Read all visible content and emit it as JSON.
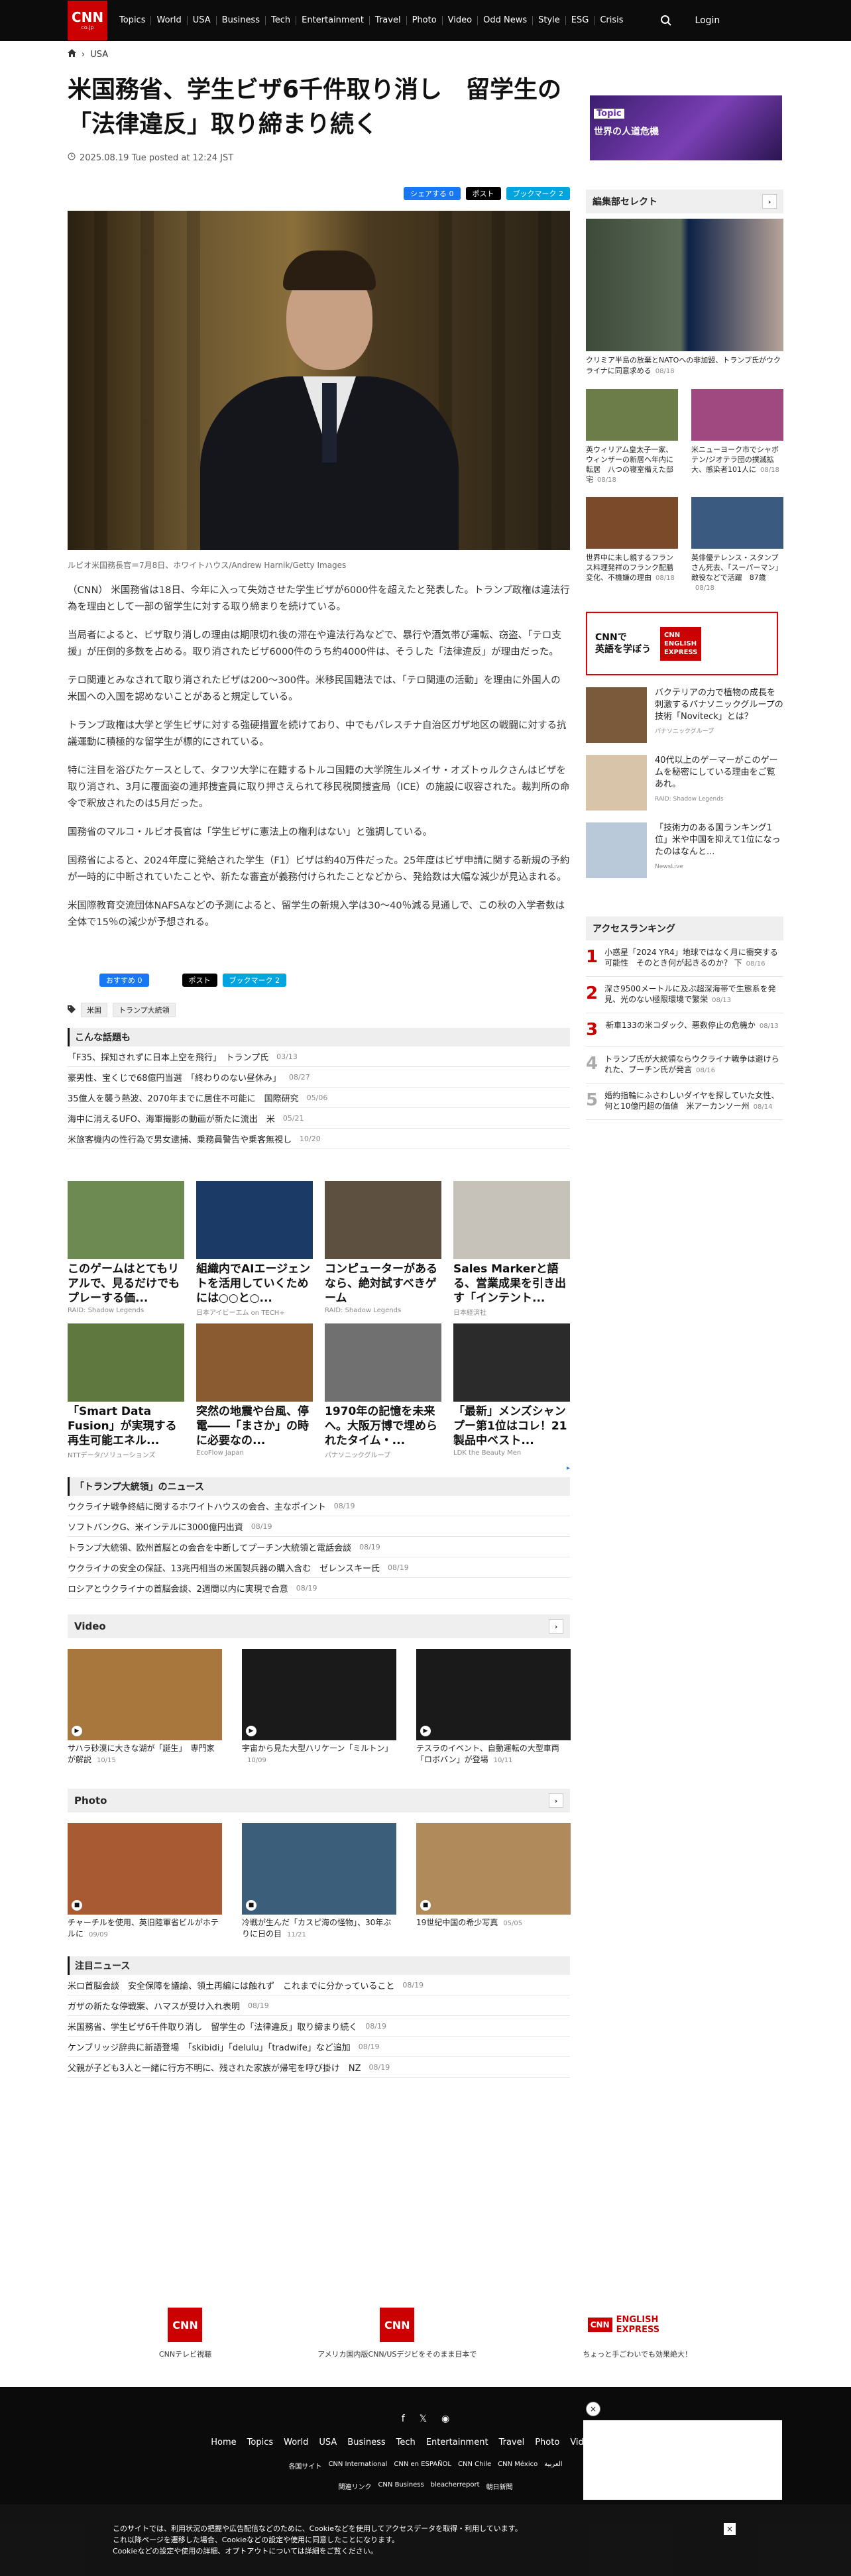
{
  "header": {
    "logo": "CNN",
    "logo_sub": "co.jp",
    "nav": [
      "Topics",
      "World",
      "USA",
      "Business",
      "Tech",
      "Entertainment",
      "Travel",
      "Photo",
      "Video",
      "Odd News",
      "Style",
      "ESG",
      "Crisis"
    ],
    "login": "Login"
  },
  "breadcrumb": {
    "section": "USA"
  },
  "article": {
    "title": "米国務省、学生ビザ6千件取り消し　留学生の「法律違反」取り締まり続く",
    "date": "2025.08.19 Tue posted at 12:24 JST",
    "share": {
      "facebook": "シェアする 0",
      "x": "ポスト",
      "hatena": "ブックマーク 2"
    },
    "caption": "ルビオ米国務長官＝7月8日、ホワイトハウス/Andrew Harnik/Getty Images",
    "paragraphs": [
      "（CNN） 米国務省は18日、今年に入って失効させた学生ビザが6000件を超えたと発表した。トランプ政権は違法行為を理由として一部の留学生に対する取り締まりを続けている。",
      "当局者によると、ビザ取り消しの理由は期限切れ後の滞在や違法行為などで、暴行や酒気帯び運転、窃盗、「テロ支援」が圧倒的多数を占める。取り消されたビザ6000件のうち約4000件は、そうした「法律違反」が理由だった。",
      "テロ関連とみなされて取り消されたビザは200～300件。米移民国籍法では、「テロ関連の活動」を理由に外国人の米国への入国を認めないことがあると規定している。",
      "トランプ政権は大学と学生ビザに対する強硬措置を続けており、中でもパレスチナ自治区ガザ地区の戦闘に対する抗議運動に積極的な留学生が標的にされている。",
      "特に注目を浴びたケースとして、タフツ大学に在籍するトルコ国籍の大学院生ルメイサ・オズトゥルクさんはビザを取り消され、3月に覆面姿の連邦捜査員に取り押さえられて移民税関捜査局（ICE）の施設に収容された。裁判所の命令で釈放されたのは5月だった。",
      "国務省のマルコ・ルビオ長官は「学生ビザに憲法上の権利はない」と強調している。",
      "国務省によると、2024年度に発給された学生（F1）ビザは約40万件だった。25年度はビザ申請に関する新規の予約が一時的に中断されていたことや、新たな審査が義務付けられたことなどから、発給数は大幅な減少が見込まれる。",
      "米国際教育交流団体NAFSAなどの予測によると、留学生の新規入学は30～40％減る見通しで、この秋の入学者数は全体で15％の減少が予想される。"
    ],
    "share2": {
      "facebook": "おすすめ 0",
      "x": "ポスト",
      "hatena": "ブックマーク 2"
    },
    "tags": [
      "米国",
      "トランプ大統領"
    ]
  },
  "related": {
    "heading": "こんな話題も",
    "items": [
      {
        "title": "「F35、採知されずに日本上空を飛行」　トランプ氏",
        "date": "03/13"
      },
      {
        "title": "豪男性、宝くじで68億円当選　「終わりのない昼休み」",
        "date": "08/27"
      },
      {
        "title": "35億人を襲う熱波、2070年までに居住不可能に　国際研究",
        "date": "05/06"
      },
      {
        "title": "海中に消えるUFO、海軍撮影の動画が新たに流出　米",
        "date": "05/21"
      },
      {
        "title": "米旅客機内の性行為で男女逮捕、乗務員警告や乗客無視し",
        "date": "10/20"
      }
    ]
  },
  "ads": [
    {
      "title": "このゲームはとてもリアルで、見るだけでもプレーする価...",
      "source": "RAID: Shadow Legends",
      "color": "#6d8a52"
    },
    {
      "title": "組織内でAIエージェントを活用していくためには○○と○...",
      "source": "日本アイビーエム on TECH+",
      "color": "#1c3a66"
    },
    {
      "title": "コンピューターがあるなら、絶対試すべきゲーム",
      "source": "RAID: Shadow Legends",
      "color": "#5d5040"
    },
    {
      "title": "Sales Markerと語る、営業成果を引き出す「インテント...",
      "source": "日本経済社",
      "color": "#c7c2b9"
    },
    {
      "title": "「Smart Data Fusion」が実現する再生可能エネル...",
      "source": "NTTデータ/ソリューションズ",
      "color": "#5f7840"
    },
    {
      "title": "突然の地震や台風、停電――「まさか」の時に必要なの...",
      "source": "EcoFlow Japan",
      "color": "#8a5a30"
    },
    {
      "title": "1970年の記憶を未来へ。大阪万博で埋められたタイム・...",
      "source": "パナソニックグループ",
      "color": "#707070"
    },
    {
      "title": "「最新」メンズシャンプー第1位はコレ！21製品中ベスト...",
      "source": "LDK the Beauty Men",
      "color": "#2b2b2b"
    }
  ],
  "trump_news": {
    "heading": "「トランプ大統領」のニュース",
    "items": [
      {
        "title": "ウクライナ戦争終結に関するホワイトハウスの会合、主なポイント",
        "date": "08/19"
      },
      {
        "title": "ソフトバンクG、米インテルに3000億円出資",
        "date": "08/19"
      },
      {
        "title": "トランプ大統領、欧州首脳との会合を中断してプーチン大統領と電話会談",
        "date": "08/19"
      },
      {
        "title": "ウクライナの安全の保証、13兆円相当の米国製兵器の購入含む　ゼレンスキー氏",
        "date": "08/19"
      },
      {
        "title": "ロシアとウクライナの首脳会談、2週間以内に実現で合意",
        "date": "08/19"
      }
    ]
  },
  "video": {
    "heading": "Video",
    "items": [
      {
        "title": "サハラ砂漠に大きな湖が「誕生」　専門家が解説",
        "date": "10/15",
        "color": "#a8773d"
      },
      {
        "title": "宇宙から見た大型ハリケーン「ミルトン」",
        "date": "10/09",
        "color": "#1a1a1a"
      },
      {
        "title": "テスラのイベント、自動運転の大型車両「ロボバン」が登場",
        "date": "10/11",
        "color": "#1a1a1a"
      }
    ]
  },
  "photo": {
    "heading": "Photo",
    "items": [
      {
        "title": "チャーチルを使用、英旧陸軍省ビルがホテルに",
        "date": "09/09",
        "color": "#a85a33"
      },
      {
        "title": "冷戦が生んだ「カスピ海の怪物」、30年ぶりに日の目",
        "date": "11/21",
        "color": "#3b5f7a"
      },
      {
        "title": "19世紀中国の希少写真",
        "date": "05/05",
        "color": "#b08a5a"
      }
    ]
  },
  "featured": {
    "heading": "注目ニュース",
    "items": [
      {
        "title": "米ロ首脳会談　安全保障を議論、領土再編には触れず　これまでに分かっていること",
        "date": "08/19"
      },
      {
        "title": "ガザの新たな停戦案、ハマスが受け入れ表明",
        "date": "08/19"
      },
      {
        "title": "米国務省、学生ビザ6千件取り消し　留学生の「法律違反」取り締まり続く",
        "date": "08/19"
      },
      {
        "title": "ケンブリッジ辞典に新語登場　「skibidi」「delulu」「tradwife」など追加",
        "date": "08/19"
      },
      {
        "title": "父親が子ども3人と一緒に行方不明に、残された家族が帰宅を呼び掛け　NZ",
        "date": "08/19"
      }
    ]
  },
  "sidebar": {
    "topic_label": "Topic",
    "topic_title": "世界の人道危機",
    "editor_heading": "編集部セレクト",
    "big": {
      "title": "クリミア半島の放棄とNATOへの非加盟、トランプ氏がウクライナに同意求める",
      "date": "08/18"
    },
    "small": [
      {
        "title": "英ウィリアム皇太子一家、ウィンザーの新居へ年内に転居　八つの寝室備えた邸宅",
        "date": "08/18",
        "color": "#6d7d4a"
      },
      {
        "title": "米ニューヨーク市でシャボテン/ジオテラ団の撲滅拡大、感染者101人に",
        "date": "08/18",
        "color": "#a04880"
      },
      {
        "title": "世界中に未し親するフランス料理発祥のフランク配膳変化、不機嫌の理由",
        "date": "08/18",
        "color": "#7a4a2a"
      },
      {
        "title": "英俳優テレンス・スタンプさん死去、「スーパーマン」敵役などで活躍　87歳",
        "date": "08/18",
        "color": "#3a5a80"
      }
    ],
    "english_left": "CNNで\n英語を学ぼう",
    "english_right": "CNN\nENGLISH\nEXPRESS",
    "pr": [
      {
        "title": "バクテリアの力で植物の成長を刺激するパナソニックグループの技術「Noviteck」とは？",
        "source": "パナソニックグループ",
        "color": "#7a5a3a"
      },
      {
        "title": "40代以上のゲーマーがこのゲームを秘密にしている理由をご覧あれ。",
        "source": "RAID: Shadow Legends",
        "color": "#d8c4a8"
      },
      {
        "title": "「技術力のある国ランキング1位」米や中国を抑えて1位になったのはなんと...",
        "source": "NewsLive",
        "color": "#b9c9d9"
      }
    ],
    "ranking_heading": "アクセスランキング",
    "ranking": [
      {
        "title": "小惑星「2024 YR4」地球ではなく月に衝突する可能性　そのとき何が起きるのか？ 下",
        "date": "08/16"
      },
      {
        "title": "深さ9500メートルに及ぶ超深海帯で生態系を発見、光のない極限環境で繁栄",
        "date": "08/13"
      },
      {
        "title": "新車133の米コダック、悪数停止の危機か",
        "date": "08/13"
      },
      {
        "title": "トランプ氏が大統領ならウクライナ戦争は避けられた、プーチン氏が発言",
        "date": "08/16"
      },
      {
        "title": "婚約指輪にふさわしいダイヤを探していた女性、何と10億円超の価値　米アーカンソー州",
        "date": "08/14"
      }
    ]
  },
  "prefooter": [
    {
      "logo": "CNN",
      "label": "CNNテレビ視聴"
    },
    {
      "logo": "CNN",
      "label": "アメリカ国内版CNN/USデジビをそのまま日本で"
    },
    {
      "logo": "ENGLISH EXPRESS",
      "label": "ちょっと手ごわいでも効果絶大！"
    }
  ],
  "footer": {
    "nav": [
      "Home",
      "Topics",
      "World",
      "USA",
      "Business",
      "Tech",
      "Entertainment",
      "Travel",
      "Photo",
      "Video",
      "Odd N..."
    ],
    "links": [
      "各国サイト",
      "CNN International",
      "CNN en ESPAÑOL",
      "CNN Chile",
      "CNN México",
      "العربية"
    ],
    "links2": [
      "関連リンク",
      "CNN Business",
      "bleacherreport",
      "朝日新聞"
    ]
  },
  "cookie": {
    "text1": "このサイトでは、利用状況の把握や広告配信などのために、Cookieなどを使用してアクセスデータを取得・利用しています。",
    "text2": "これ以降ページを遷移した場合、Cookieなどの設定や使用に同意したことになります。",
    "text3": "Cookieなどの設定や使用の詳細、オプトアウトについては詳細をご覧ください。",
    "close": "×"
  }
}
